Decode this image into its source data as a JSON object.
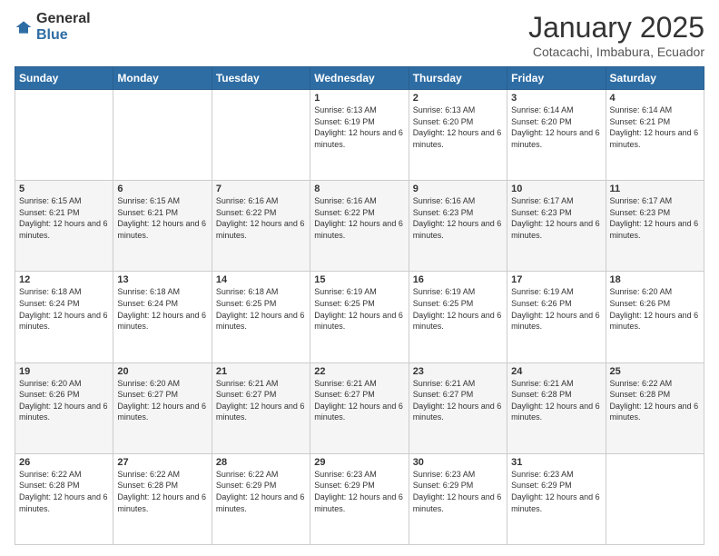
{
  "logo": {
    "general": "General",
    "blue": "Blue"
  },
  "header": {
    "title": "January 2025",
    "subtitle": "Cotacachi, Imbabura, Ecuador"
  },
  "weekdays": [
    "Sunday",
    "Monday",
    "Tuesday",
    "Wednesday",
    "Thursday",
    "Friday",
    "Saturday"
  ],
  "weeks": [
    [
      {
        "day": "",
        "info": ""
      },
      {
        "day": "",
        "info": ""
      },
      {
        "day": "",
        "info": ""
      },
      {
        "day": "1",
        "info": "Sunrise: 6:13 AM\nSunset: 6:19 PM\nDaylight: 12 hours\nand 6 minutes."
      },
      {
        "day": "2",
        "info": "Sunrise: 6:13 AM\nSunset: 6:20 PM\nDaylight: 12 hours\nand 6 minutes."
      },
      {
        "day": "3",
        "info": "Sunrise: 6:14 AM\nSunset: 6:20 PM\nDaylight: 12 hours\nand 6 minutes."
      },
      {
        "day": "4",
        "info": "Sunrise: 6:14 AM\nSunset: 6:21 PM\nDaylight: 12 hours\nand 6 minutes."
      }
    ],
    [
      {
        "day": "5",
        "info": "Sunrise: 6:15 AM\nSunset: 6:21 PM\nDaylight: 12 hours\nand 6 minutes."
      },
      {
        "day": "6",
        "info": "Sunrise: 6:15 AM\nSunset: 6:21 PM\nDaylight: 12 hours\nand 6 minutes."
      },
      {
        "day": "7",
        "info": "Sunrise: 6:16 AM\nSunset: 6:22 PM\nDaylight: 12 hours\nand 6 minutes."
      },
      {
        "day": "8",
        "info": "Sunrise: 6:16 AM\nSunset: 6:22 PM\nDaylight: 12 hours\nand 6 minutes."
      },
      {
        "day": "9",
        "info": "Sunrise: 6:16 AM\nSunset: 6:23 PM\nDaylight: 12 hours\nand 6 minutes."
      },
      {
        "day": "10",
        "info": "Sunrise: 6:17 AM\nSunset: 6:23 PM\nDaylight: 12 hours\nand 6 minutes."
      },
      {
        "day": "11",
        "info": "Sunrise: 6:17 AM\nSunset: 6:23 PM\nDaylight: 12 hours\nand 6 minutes."
      }
    ],
    [
      {
        "day": "12",
        "info": "Sunrise: 6:18 AM\nSunset: 6:24 PM\nDaylight: 12 hours\nand 6 minutes."
      },
      {
        "day": "13",
        "info": "Sunrise: 6:18 AM\nSunset: 6:24 PM\nDaylight: 12 hours\nand 6 minutes."
      },
      {
        "day": "14",
        "info": "Sunrise: 6:18 AM\nSunset: 6:25 PM\nDaylight: 12 hours\nand 6 minutes."
      },
      {
        "day": "15",
        "info": "Sunrise: 6:19 AM\nSunset: 6:25 PM\nDaylight: 12 hours\nand 6 minutes."
      },
      {
        "day": "16",
        "info": "Sunrise: 6:19 AM\nSunset: 6:25 PM\nDaylight: 12 hours\nand 6 minutes."
      },
      {
        "day": "17",
        "info": "Sunrise: 6:19 AM\nSunset: 6:26 PM\nDaylight: 12 hours\nand 6 minutes."
      },
      {
        "day": "18",
        "info": "Sunrise: 6:20 AM\nSunset: 6:26 PM\nDaylight: 12 hours\nand 6 minutes."
      }
    ],
    [
      {
        "day": "19",
        "info": "Sunrise: 6:20 AM\nSunset: 6:26 PM\nDaylight: 12 hours\nand 6 minutes."
      },
      {
        "day": "20",
        "info": "Sunrise: 6:20 AM\nSunset: 6:27 PM\nDaylight: 12 hours\nand 6 minutes."
      },
      {
        "day": "21",
        "info": "Sunrise: 6:21 AM\nSunset: 6:27 PM\nDaylight: 12 hours\nand 6 minutes."
      },
      {
        "day": "22",
        "info": "Sunrise: 6:21 AM\nSunset: 6:27 PM\nDaylight: 12 hours\nand 6 minutes."
      },
      {
        "day": "23",
        "info": "Sunrise: 6:21 AM\nSunset: 6:27 PM\nDaylight: 12 hours\nand 6 minutes."
      },
      {
        "day": "24",
        "info": "Sunrise: 6:21 AM\nSunset: 6:28 PM\nDaylight: 12 hours\nand 6 minutes."
      },
      {
        "day": "25",
        "info": "Sunrise: 6:22 AM\nSunset: 6:28 PM\nDaylight: 12 hours\nand 6 minutes."
      }
    ],
    [
      {
        "day": "26",
        "info": "Sunrise: 6:22 AM\nSunset: 6:28 PM\nDaylight: 12 hours\nand 6 minutes."
      },
      {
        "day": "27",
        "info": "Sunrise: 6:22 AM\nSunset: 6:28 PM\nDaylight: 12 hours\nand 6 minutes."
      },
      {
        "day": "28",
        "info": "Sunrise: 6:22 AM\nSunset: 6:29 PM\nDaylight: 12 hours\nand 6 minutes."
      },
      {
        "day": "29",
        "info": "Sunrise: 6:23 AM\nSunset: 6:29 PM\nDaylight: 12 hours\nand 6 minutes."
      },
      {
        "day": "30",
        "info": "Sunrise: 6:23 AM\nSunset: 6:29 PM\nDaylight: 12 hours\nand 6 minutes."
      },
      {
        "day": "31",
        "info": "Sunrise: 6:23 AM\nSunset: 6:29 PM\nDaylight: 12 hours\nand 6 minutes."
      },
      {
        "day": "",
        "info": ""
      }
    ]
  ]
}
